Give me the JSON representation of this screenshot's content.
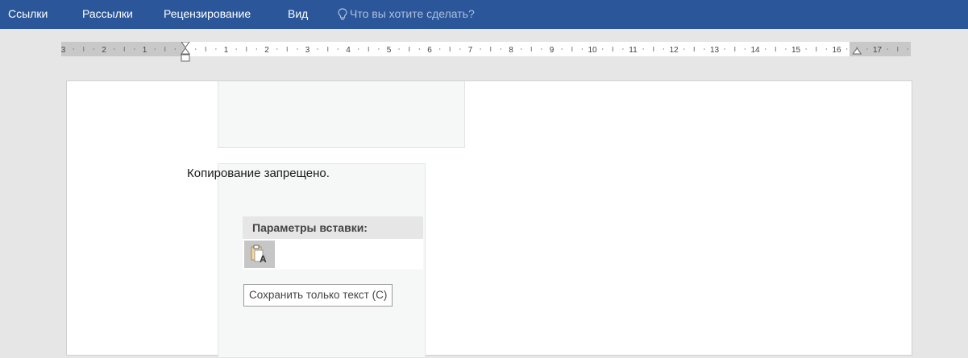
{
  "ribbon": {
    "tabs": [
      {
        "label": "Ссылки"
      },
      {
        "label": "Рассылки"
      },
      {
        "label": "Рецензирование"
      },
      {
        "label": "Вид"
      }
    ],
    "tell_me_placeholder": "Что вы хотите сделать?",
    "bg_color": "#2b579a"
  },
  "ruler": {
    "labels": [
      "3",
      "2",
      "1",
      "1",
      "2",
      "3",
      "4",
      "5",
      "6",
      "7",
      "8",
      "9",
      "10",
      "11",
      "12",
      "13",
      "14",
      "15",
      "16",
      "17"
    ]
  },
  "document": {
    "text": "Копирование запрещено."
  },
  "paste_menu": {
    "header": "Параметры вставки:",
    "option_icon": "clipboard-text-icon",
    "tooltip": "Сохранить только текст (С)"
  }
}
